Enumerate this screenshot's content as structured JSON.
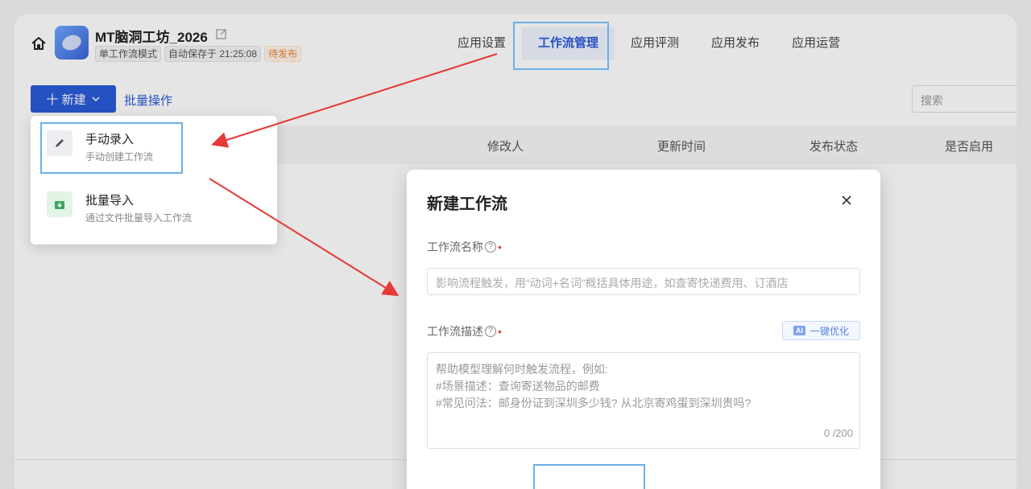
{
  "header": {
    "app_title": "MT脑洞工坊_2026",
    "badges": [
      "单工作流模式",
      "自动保存于 21:25:08"
    ],
    "status": "待发布",
    "tabs": [
      "应用设置",
      "工作流管理",
      "应用评测",
      "应用发布",
      "应用运营"
    ],
    "active_tab": "工作流管理"
  },
  "toolbar": {
    "new_label": "十 新建",
    "batch_label": "批量操作",
    "search_placeholder": "搜索"
  },
  "table": {
    "columns": [
      "修改人",
      "更新时间",
      "发布状态",
      "是否启用"
    ]
  },
  "dropdown": {
    "items": [
      {
        "title": "手动录入",
        "subtitle": "手动创建工作流"
      },
      {
        "title": "批量导入",
        "subtitle": "通过文件批量导入工作流"
      }
    ]
  },
  "modal": {
    "title": "新建工作流",
    "name_label": "工作流名称",
    "name_placeholder": "影响流程触发，用“动词+名词”概括具体用途，如查寄快递费用、订酒店",
    "desc_label": "工作流描述",
    "ai_tag": "AI",
    "ai_label": "一键优化",
    "desc_placeholder_lines": [
      "帮助模型理解何时触发流程，例如:",
      "#场景描述：查询寄送物品的邮费",
      "#常见问法：邮身份证到深圳多少钱? 从北京寄鸡蛋到深圳贵吗?"
    ],
    "counter": "0 /200"
  },
  "colors": {
    "primary": "#2a5bd7",
    "highlight": "#6ab0e8",
    "arrow": "#e53935",
    "pending": "#e8833a"
  }
}
